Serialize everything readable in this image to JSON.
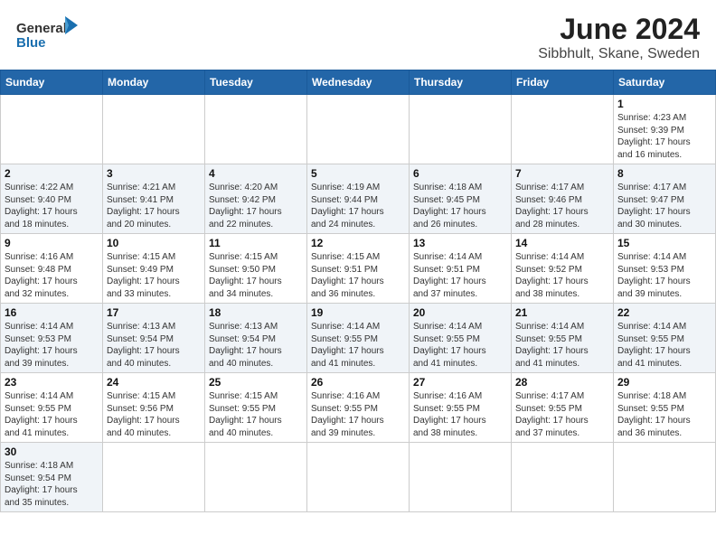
{
  "header": {
    "logo_general": "General",
    "logo_blue": "Blue",
    "title": "June 2024",
    "subtitle": "Sibbhult, Skane, Sweden"
  },
  "weekdays": [
    "Sunday",
    "Monday",
    "Tuesday",
    "Wednesday",
    "Thursday",
    "Friday",
    "Saturday"
  ],
  "weeks": [
    [
      {
        "day": "",
        "info": ""
      },
      {
        "day": "",
        "info": ""
      },
      {
        "day": "",
        "info": ""
      },
      {
        "day": "",
        "info": ""
      },
      {
        "day": "",
        "info": ""
      },
      {
        "day": "",
        "info": ""
      },
      {
        "day": "1",
        "info": "Sunrise: 4:23 AM\nSunset: 9:39 PM\nDaylight: 17 hours\nand 16 minutes."
      }
    ],
    [
      {
        "day": "2",
        "info": "Sunrise: 4:22 AM\nSunset: 9:40 PM\nDaylight: 17 hours\nand 18 minutes."
      },
      {
        "day": "3",
        "info": "Sunrise: 4:21 AM\nSunset: 9:41 PM\nDaylight: 17 hours\nand 20 minutes."
      },
      {
        "day": "4",
        "info": "Sunrise: 4:20 AM\nSunset: 9:42 PM\nDaylight: 17 hours\nand 22 minutes."
      },
      {
        "day": "5",
        "info": "Sunrise: 4:19 AM\nSunset: 9:44 PM\nDaylight: 17 hours\nand 24 minutes."
      },
      {
        "day": "6",
        "info": "Sunrise: 4:18 AM\nSunset: 9:45 PM\nDaylight: 17 hours\nand 26 minutes."
      },
      {
        "day": "7",
        "info": "Sunrise: 4:17 AM\nSunset: 9:46 PM\nDaylight: 17 hours\nand 28 minutes."
      },
      {
        "day": "8",
        "info": "Sunrise: 4:17 AM\nSunset: 9:47 PM\nDaylight: 17 hours\nand 30 minutes."
      }
    ],
    [
      {
        "day": "9",
        "info": "Sunrise: 4:16 AM\nSunset: 9:48 PM\nDaylight: 17 hours\nand 32 minutes."
      },
      {
        "day": "10",
        "info": "Sunrise: 4:15 AM\nSunset: 9:49 PM\nDaylight: 17 hours\nand 33 minutes."
      },
      {
        "day": "11",
        "info": "Sunrise: 4:15 AM\nSunset: 9:50 PM\nDaylight: 17 hours\nand 34 minutes."
      },
      {
        "day": "12",
        "info": "Sunrise: 4:15 AM\nSunset: 9:51 PM\nDaylight: 17 hours\nand 36 minutes."
      },
      {
        "day": "13",
        "info": "Sunrise: 4:14 AM\nSunset: 9:51 PM\nDaylight: 17 hours\nand 37 minutes."
      },
      {
        "day": "14",
        "info": "Sunrise: 4:14 AM\nSunset: 9:52 PM\nDaylight: 17 hours\nand 38 minutes."
      },
      {
        "day": "15",
        "info": "Sunrise: 4:14 AM\nSunset: 9:53 PM\nDaylight: 17 hours\nand 39 minutes."
      }
    ],
    [
      {
        "day": "16",
        "info": "Sunrise: 4:14 AM\nSunset: 9:53 PM\nDaylight: 17 hours\nand 39 minutes."
      },
      {
        "day": "17",
        "info": "Sunrise: 4:13 AM\nSunset: 9:54 PM\nDaylight: 17 hours\nand 40 minutes."
      },
      {
        "day": "18",
        "info": "Sunrise: 4:13 AM\nSunset: 9:54 PM\nDaylight: 17 hours\nand 40 minutes."
      },
      {
        "day": "19",
        "info": "Sunrise: 4:14 AM\nSunset: 9:55 PM\nDaylight: 17 hours\nand 41 minutes."
      },
      {
        "day": "20",
        "info": "Sunrise: 4:14 AM\nSunset: 9:55 PM\nDaylight: 17 hours\nand 41 minutes."
      },
      {
        "day": "21",
        "info": "Sunrise: 4:14 AM\nSunset: 9:55 PM\nDaylight: 17 hours\nand 41 minutes."
      },
      {
        "day": "22",
        "info": "Sunrise: 4:14 AM\nSunset: 9:55 PM\nDaylight: 17 hours\nand 41 minutes."
      }
    ],
    [
      {
        "day": "23",
        "info": "Sunrise: 4:14 AM\nSunset: 9:55 PM\nDaylight: 17 hours\nand 41 minutes."
      },
      {
        "day": "24",
        "info": "Sunrise: 4:15 AM\nSunset: 9:56 PM\nDaylight: 17 hours\nand 40 minutes."
      },
      {
        "day": "25",
        "info": "Sunrise: 4:15 AM\nSunset: 9:55 PM\nDaylight: 17 hours\nand 40 minutes."
      },
      {
        "day": "26",
        "info": "Sunrise: 4:16 AM\nSunset: 9:55 PM\nDaylight: 17 hours\nand 39 minutes."
      },
      {
        "day": "27",
        "info": "Sunrise: 4:16 AM\nSunset: 9:55 PM\nDaylight: 17 hours\nand 38 minutes."
      },
      {
        "day": "28",
        "info": "Sunrise: 4:17 AM\nSunset: 9:55 PM\nDaylight: 17 hours\nand 37 minutes."
      },
      {
        "day": "29",
        "info": "Sunrise: 4:18 AM\nSunset: 9:55 PM\nDaylight: 17 hours\nand 36 minutes."
      }
    ],
    [
      {
        "day": "30",
        "info": "Sunrise: 4:18 AM\nSunset: 9:54 PM\nDaylight: 17 hours\nand 35 minutes."
      },
      {
        "day": "",
        "info": ""
      },
      {
        "day": "",
        "info": ""
      },
      {
        "day": "",
        "info": ""
      },
      {
        "day": "",
        "info": ""
      },
      {
        "day": "",
        "info": ""
      },
      {
        "day": "",
        "info": ""
      }
    ]
  ]
}
